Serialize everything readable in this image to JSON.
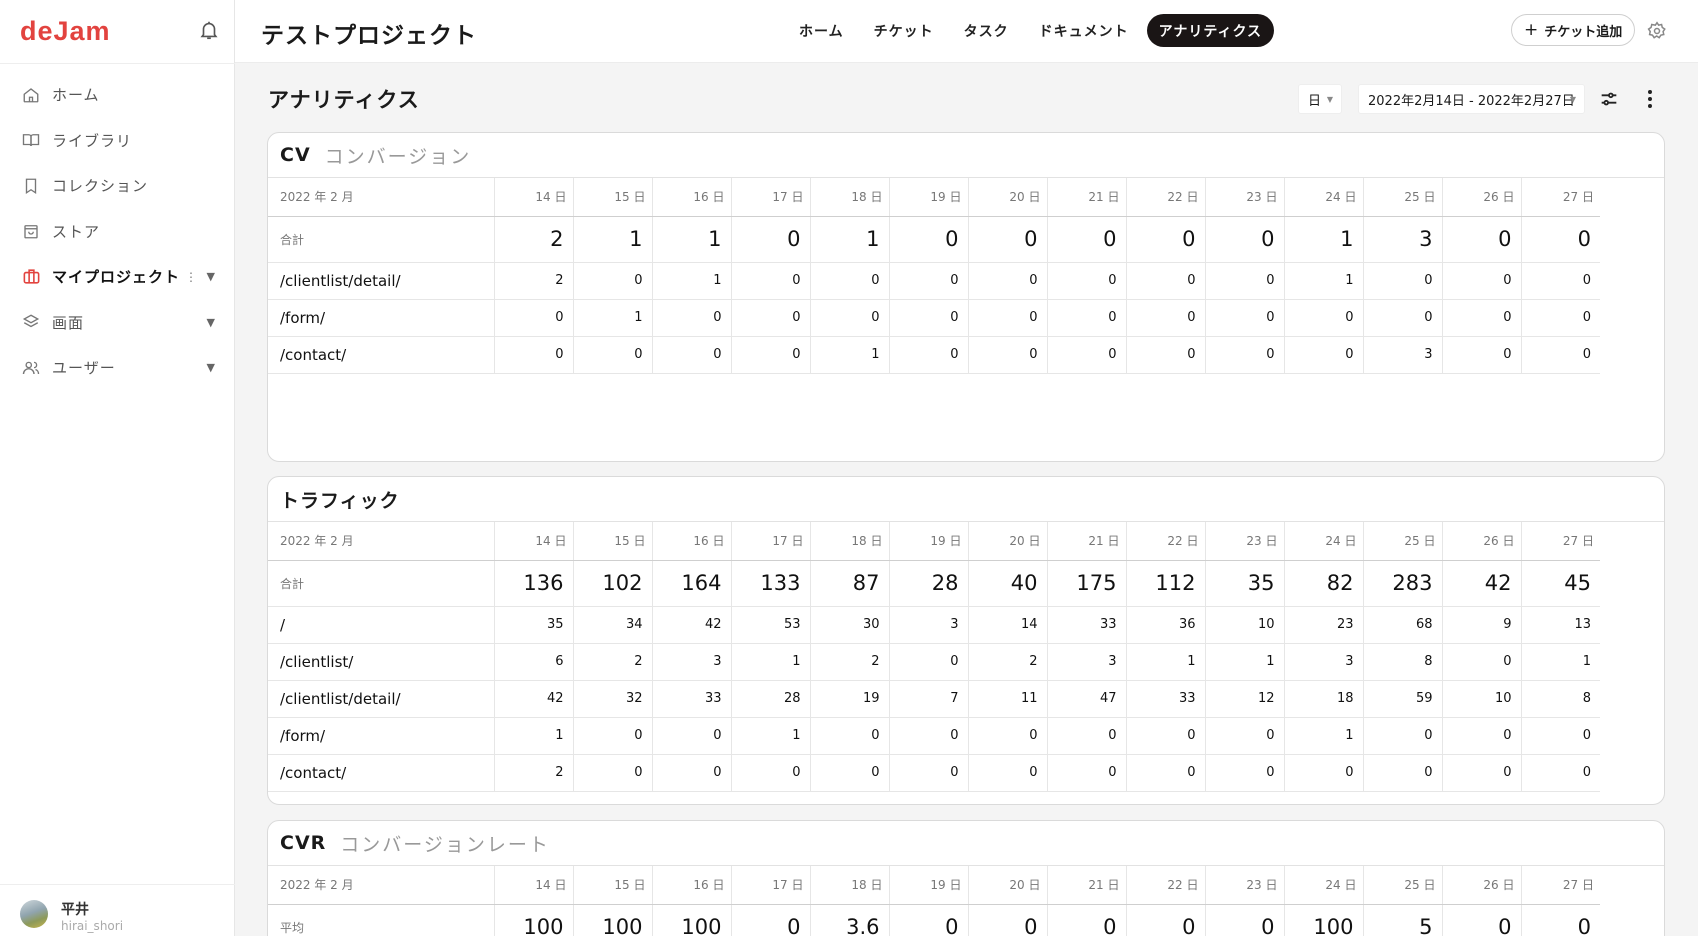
{
  "sidebar": {
    "logo": "deJam",
    "items": [
      {
        "label": "ホーム"
      },
      {
        "label": "ライブラリ"
      },
      {
        "label": "コレクション"
      },
      {
        "label": "ストア"
      },
      {
        "label": "マイプロジェクト"
      },
      {
        "label": "画面"
      },
      {
        "label": "ユーザー"
      }
    ],
    "user": {
      "name": "平井",
      "id": "hirai_shori"
    }
  },
  "header": {
    "project_title": "テストプロジェクト",
    "tabs": [
      {
        "label": "ホーム"
      },
      {
        "label": "チケット"
      },
      {
        "label": "タスク"
      },
      {
        "label": "ドキュメント"
      },
      {
        "label": "アナリティクス"
      }
    ],
    "add_ticket": "チケット追加"
  },
  "page": {
    "title": "アナリティクス",
    "unit_select": "日",
    "date_range": "2022年2月14日 - 2022年2月27日"
  },
  "month_label": "2022 年 2 月",
  "days": [
    "14 日",
    "15 日",
    "16 日",
    "17 日",
    "18 日",
    "19 日",
    "20 日",
    "21 日",
    "22 日",
    "23 日",
    "24 日",
    "25 日",
    "26 日",
    "27 日"
  ],
  "cards": [
    {
      "title": "CV",
      "subtitle": "コンバージョン",
      "total_label": "合計",
      "totals": [
        "2",
        "1",
        "1",
        "0",
        "1",
        "0",
        "0",
        "0",
        "0",
        "0",
        "1",
        "3",
        "0",
        "0"
      ],
      "rows": [
        {
          "label": "/clientlist/detail/",
          "values": [
            "2",
            "0",
            "1",
            "0",
            "0",
            "0",
            "0",
            "0",
            "0",
            "0",
            "1",
            "0",
            "0",
            "0"
          ]
        },
        {
          "label": "/form/",
          "values": [
            "0",
            "1",
            "0",
            "0",
            "0",
            "0",
            "0",
            "0",
            "0",
            "0",
            "0",
            "0",
            "0",
            "0"
          ]
        },
        {
          "label": "/contact/",
          "values": [
            "0",
            "0",
            "0",
            "0",
            "1",
            "0",
            "0",
            "0",
            "0",
            "0",
            "0",
            "3",
            "0",
            "0"
          ]
        }
      ]
    },
    {
      "title": "トラフィック",
      "subtitle": "",
      "total_label": "合計",
      "totals": [
        "136",
        "102",
        "164",
        "133",
        "87",
        "28",
        "40",
        "175",
        "112",
        "35",
        "82",
        "283",
        "42",
        "45"
      ],
      "rows": [
        {
          "label": "/",
          "values": [
            "35",
            "34",
            "42",
            "53",
            "30",
            "3",
            "14",
            "33",
            "36",
            "10",
            "23",
            "68",
            "9",
            "13"
          ]
        },
        {
          "label": "/clientlist/",
          "values": [
            "6",
            "2",
            "3",
            "1",
            "2",
            "0",
            "2",
            "3",
            "1",
            "1",
            "3",
            "8",
            "0",
            "1"
          ]
        },
        {
          "label": "/clientlist/detail/",
          "values": [
            "42",
            "32",
            "33",
            "28",
            "19",
            "7",
            "11",
            "47",
            "33",
            "12",
            "18",
            "59",
            "10",
            "8"
          ]
        },
        {
          "label": "/form/",
          "values": [
            "1",
            "0",
            "0",
            "1",
            "0",
            "0",
            "0",
            "0",
            "0",
            "0",
            "1",
            "0",
            "0",
            "0"
          ]
        },
        {
          "label": "/contact/",
          "values": [
            "2",
            "0",
            "0",
            "0",
            "0",
            "0",
            "0",
            "0",
            "0",
            "0",
            "0",
            "0",
            "0",
            "0"
          ]
        }
      ]
    },
    {
      "title": "CVR",
      "subtitle": "コンバージョンレート",
      "total_label": "平均",
      "totals": [
        "100",
        "100",
        "100",
        "0",
        "3.6",
        "0",
        "0",
        "0",
        "0",
        "0",
        "100",
        "5",
        "0",
        "0"
      ],
      "rows": []
    }
  ]
}
